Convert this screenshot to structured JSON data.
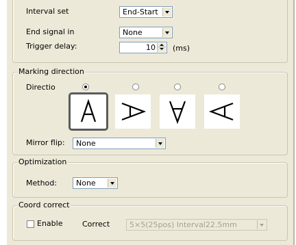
{
  "timing": {
    "interval_set": {
      "label": "Interval set",
      "value": "End-Start"
    },
    "end_signal": {
      "label": "End signal in",
      "value": "None"
    },
    "trigger_delay": {
      "label": "Trigger delay:",
      "value": "10",
      "unit": "(ms)"
    }
  },
  "marking_direction": {
    "title": "Marking direction",
    "direction_label": "Directio",
    "options": [
      {
        "glyph": "A",
        "rotation": "0",
        "selected": true
      },
      {
        "glyph": "A",
        "rotation": "90",
        "selected": false
      },
      {
        "glyph": "A",
        "rotation": "180",
        "selected": false
      },
      {
        "glyph": "A",
        "rotation": "270",
        "selected": false
      }
    ],
    "mirror_flip": {
      "label": "Mirror flip:",
      "value": "None"
    }
  },
  "optimization": {
    "title": "Optimization",
    "method": {
      "label": "Method:",
      "value": "None"
    }
  },
  "coord_correct": {
    "title": "Coord correct",
    "enable_label": "Enable",
    "enabled": false,
    "correct_label": "Correct",
    "correct_value": "5×5(25pos) Interval22.5mm"
  }
}
